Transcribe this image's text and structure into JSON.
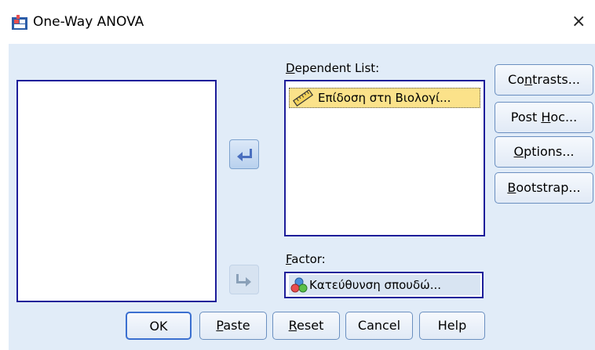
{
  "window": {
    "title": "One-Way ANOVA",
    "close_glyph": "×",
    "app_icon": "spss-dialog-icon"
  },
  "source_list": {
    "items": []
  },
  "dependent_list": {
    "label_prefix": "D",
    "label_rest": "ependent List:",
    "items": [
      {
        "text": "Επίδοση στη Βιολογί...",
        "icon": "ruler-scale-icon"
      }
    ]
  },
  "factor": {
    "label_prefix": "F",
    "label_rest": "actor:",
    "value": "Κατεύθυνση σπουδώ...",
    "icon": "nominal-variable-icon"
  },
  "side_buttons": {
    "contrasts": {
      "pre": "Co",
      "u": "n",
      "post": "trasts..."
    },
    "post_hoc": {
      "pre": "Post ",
      "u": "H",
      "post": "oc..."
    },
    "options": {
      "pre": "",
      "u": "O",
      "post": "ptions..."
    },
    "bootstrap": {
      "pre": "",
      "u": "B",
      "post": "ootstrap..."
    }
  },
  "bottom_buttons": {
    "ok": {
      "pre": "OK",
      "u": "",
      "post": ""
    },
    "paste": {
      "pre": "",
      "u": "P",
      "post": "aste"
    },
    "reset": {
      "pre": "",
      "u": "R",
      "post": "eset"
    },
    "cancel": {
      "pre": "Cancel",
      "u": "",
      "post": ""
    },
    "help": {
      "pre": "Help",
      "u": "",
      "post": ""
    }
  },
  "colors": {
    "client_bg": "#e1ecf8",
    "panel_border": "#1d1d9a",
    "selected_item_bg": "#fbe28a",
    "arrow_color": "#4a6fbf"
  }
}
